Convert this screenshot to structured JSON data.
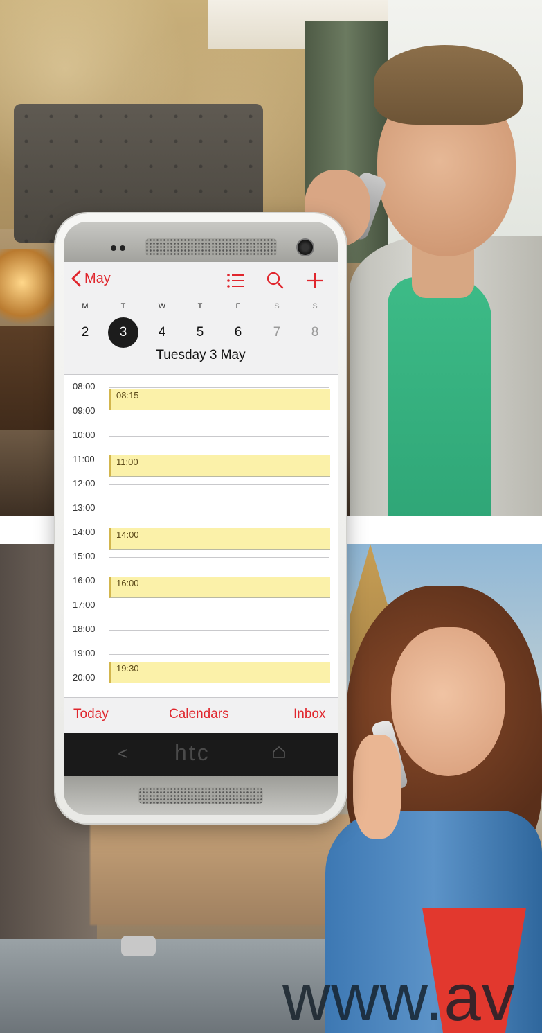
{
  "calendar": {
    "back_label": "May",
    "weekdays": [
      {
        "label": "M",
        "weekend": false
      },
      {
        "label": "T",
        "weekend": false
      },
      {
        "label": "W",
        "weekend": false
      },
      {
        "label": "T",
        "weekend": false
      },
      {
        "label": "F",
        "weekend": false
      },
      {
        "label": "S",
        "weekend": true
      },
      {
        "label": "S",
        "weekend": true
      }
    ],
    "dates": [
      {
        "label": "2",
        "selected": false,
        "weekend": false
      },
      {
        "label": "3",
        "selected": true,
        "weekend": false
      },
      {
        "label": "4",
        "selected": false,
        "weekend": false
      },
      {
        "label": "5",
        "selected": false,
        "weekend": false
      },
      {
        "label": "6",
        "selected": false,
        "weekend": false
      },
      {
        "label": "7",
        "selected": false,
        "weekend": true
      },
      {
        "label": "8",
        "selected": false,
        "weekend": true
      }
    ],
    "selected_date": "Tuesday 3 May",
    "hours": [
      "08:00",
      "09:00",
      "10:00",
      "11:00",
      "12:00",
      "13:00",
      "14:00",
      "15:00",
      "16:00",
      "17:00",
      "18:00",
      "19:00",
      "20:00"
    ],
    "events": [
      {
        "start": "08:15"
      },
      {
        "start": "11:00"
      },
      {
        "start": "14:00"
      },
      {
        "start": "16:00"
      },
      {
        "start": "19:30"
      }
    ],
    "footer": {
      "today": "Today",
      "calendars": "Calendars",
      "inbox": "Inbox"
    }
  },
  "device": {
    "brand": "htc",
    "nav_back_glyph": "<"
  },
  "icons": {
    "back": "chevron-left-icon",
    "list": "list-icon",
    "search": "search-icon",
    "add": "plus-icon",
    "home": "home-icon"
  },
  "colors": {
    "accent": "#e0262d",
    "event_fill": "#fbf1a9",
    "selected_day": "#1c1c1c"
  },
  "watermark": "www.av"
}
